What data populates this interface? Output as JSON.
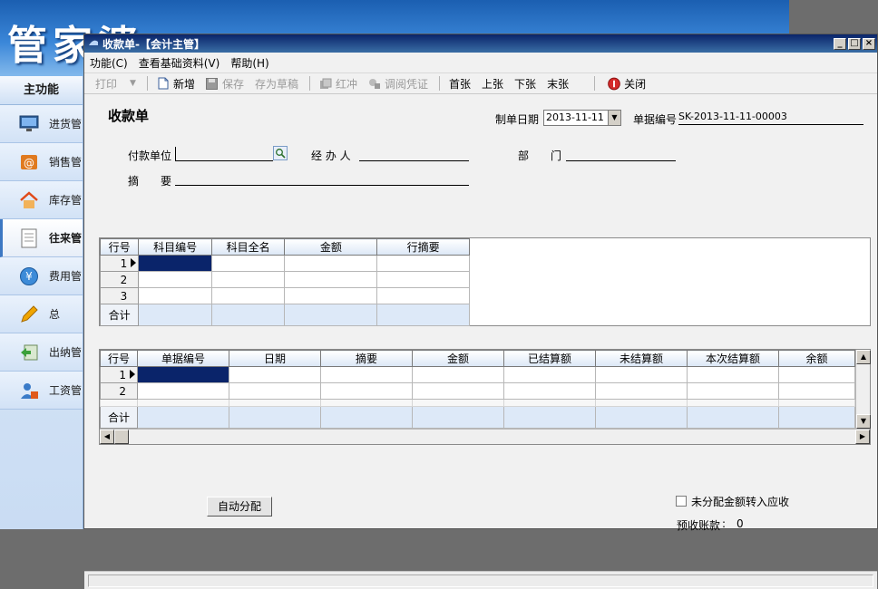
{
  "background_app": {
    "banner_title": "管家婆",
    "sidebar_title": "主功能",
    "sidebar_items": [
      {
        "label": "进货管",
        "icon": "monitor-icon"
      },
      {
        "label": "销售管",
        "icon": "envelope-icon"
      },
      {
        "label": "库存管",
        "icon": "home-icon"
      },
      {
        "label": "往来管",
        "icon": "document-icon",
        "active": true
      },
      {
        "label": "费用管",
        "icon": "yen-coin-icon"
      },
      {
        "label": "总",
        "icon": "pencil-icon"
      },
      {
        "label": "出纳管",
        "icon": "cash-out-icon"
      },
      {
        "label": "工资管",
        "icon": "payroll-icon"
      }
    ]
  },
  "dialog": {
    "title": "收款单-【会计主管】",
    "window_buttons": {
      "minimize": "_",
      "maximize": "□",
      "close": "×"
    },
    "menu": [
      "功能(C)",
      "查看基础资料(V)",
      "帮助(H)"
    ],
    "toolbar": [
      {
        "label": "打印",
        "icon": "",
        "enabled": false,
        "dropdown": true
      },
      {
        "label": "新增",
        "icon": "new-document-icon",
        "enabled": true
      },
      {
        "label": "保存",
        "icon": "save-icon",
        "enabled": false
      },
      {
        "label": "存为草稿",
        "icon": "",
        "enabled": false
      },
      {
        "label": "红冲",
        "icon": "red-reverse-icon",
        "enabled": false
      },
      {
        "label": "调阅凭证",
        "icon": "view-voucher-icon",
        "enabled": false
      },
      {
        "label": "首张",
        "icon": "",
        "enabled": true
      },
      {
        "label": "上张",
        "icon": "",
        "enabled": true
      },
      {
        "label": "下张",
        "icon": "",
        "enabled": true
      },
      {
        "label": "末张",
        "icon": "",
        "enabled": true
      },
      {
        "label": "关闭",
        "icon": "close-red-icon",
        "enabled": true
      }
    ]
  },
  "form": {
    "title": "收款单",
    "date_label": "制单日期",
    "date_value": "2013-11-11",
    "doc_no_label": "单据编号",
    "doc_no_value": "SK-2013-11-11-00003",
    "payer_label": "付款单位",
    "handler_label": "经 办 人",
    "dept_label": "部　　门",
    "summary_label": "摘　　要"
  },
  "grid1": {
    "columns": [
      "行号",
      "科目编号",
      "科目全名",
      "金额",
      "行摘要"
    ],
    "rows": [
      "1",
      "2",
      "3"
    ],
    "total_label": "合计"
  },
  "grid2": {
    "columns": [
      "行号",
      "单据编号",
      "日期",
      "摘要",
      "金额",
      "已结算额",
      "未结算额",
      "本次结算额",
      "余额"
    ],
    "rows": [
      "1",
      "2"
    ],
    "total_label": "合计"
  },
  "footer": {
    "auto_allocate": "自动分配",
    "unallocated_checkbox": "未分配金额转入应收",
    "unallocated_checked": false,
    "prepaid_label": "预收账款",
    "prepaid_value": "0"
  }
}
